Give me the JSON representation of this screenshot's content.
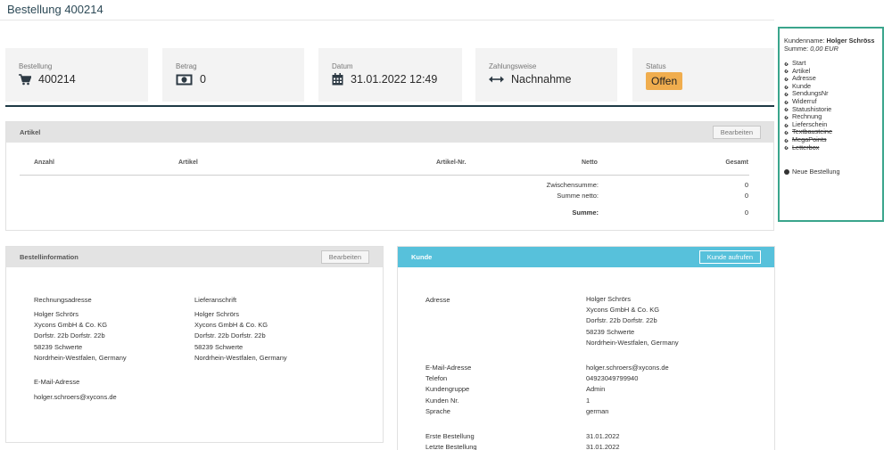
{
  "page": {
    "title": "Bestellung 400214"
  },
  "cards": [
    {
      "label": "Bestellung",
      "value": "400214",
      "icon": "cart-icon"
    },
    {
      "label": "Betrag",
      "value": "0",
      "icon": "money-icon"
    },
    {
      "label": "Datum",
      "value": "31.01.2022 12:49",
      "icon": "calendar-icon"
    },
    {
      "label": "Zahlungsweise",
      "value": "Nachnahme",
      "icon": "exchange-icon"
    },
    {
      "label": "Status",
      "value": "Offen",
      "badge_color": "#f0ad4e"
    }
  ],
  "artikel": {
    "title": "Artikel",
    "edit_label": "Bearbeiten",
    "columns": [
      "Anzahl",
      "Artikel",
      "Artikel-Nr.",
      "Netto",
      "Gesamt"
    ],
    "summary": [
      {
        "label": "Zwischensumme:",
        "value": "0"
      },
      {
        "label": "Summe netto:",
        "value": "0"
      },
      {
        "label": "Summe:",
        "value": "0"
      }
    ]
  },
  "bestellinfo": {
    "title": "Bestellinformation",
    "edit_label": "Bearbeiten",
    "rechnung_label": "Rechnungsadresse",
    "rechnung_lines": [
      "Holger Schrörs",
      "Xycons GmbH & Co. KG",
      "Dorfstr. 22b Dorfstr. 22b",
      "58239 Schwerte",
      "Nordrhein-Westfalen, Germany"
    ],
    "liefer_label": "Lieferanschrift",
    "liefer_lines": [
      "Holger Schrörs",
      "Xycons GmbH & Co. KG",
      "Dorfstr. 22b Dorfstr. 22b",
      "58239 Schwerte",
      "Nordrhein-Westfalen, Germany"
    ],
    "email_label": "E-Mail-Adresse",
    "email": "holger.schroers@xycons.de"
  },
  "kunde": {
    "title": "Kunde",
    "button_label": "Kunde aufrufen",
    "adresse_label": "Adresse",
    "adresse_lines": [
      "Holger Schrörs",
      "Xycons GmbH & Co. KG",
      "Dorfstr. 22b Dorfstr. 22b",
      "58239 Schwerte",
      "Nordrhein-Westfalen, Germany"
    ],
    "fields": [
      {
        "label": "E-Mail-Adresse",
        "value": "holger.schroers@xycons.de"
      },
      {
        "label": "Telefon",
        "value": "04923049799940"
      },
      {
        "label": "Kundengruppe",
        "value": "Admin"
      },
      {
        "label": "Kunden Nr.",
        "value": "1"
      },
      {
        "label": "Sprache",
        "value": "german"
      }
    ],
    "dates": [
      {
        "label": "Erste Bestellung",
        "value": "31.01.2022"
      },
      {
        "label": "Letzte Bestellung",
        "value": "31.01.2022"
      }
    ],
    "header_color": "#57c1db"
  },
  "sidebar": {
    "kundenname_label": "Kundenname:",
    "kundenname": "Holger Schröss",
    "summe_label": "Summe:",
    "summe": "0,00 EUR",
    "links": [
      {
        "label": "Start",
        "strike": false
      },
      {
        "label": "Artikel",
        "strike": false
      },
      {
        "label": "Adresse",
        "strike": false
      },
      {
        "label": "Kunde",
        "strike": false
      },
      {
        "label": "SendungsNr",
        "strike": false
      },
      {
        "label": "Widerruf",
        "strike": false
      },
      {
        "label": "Statushistorie",
        "strike": false
      },
      {
        "label": "Rechnung",
        "strike": false
      },
      {
        "label": "Lieferschein",
        "strike": false
      },
      {
        "label": "Textbausteine",
        "strike": true
      },
      {
        "label": "MegaPoints",
        "strike": true
      },
      {
        "label": "Letterbox",
        "strike": true
      }
    ],
    "new_order_label": "Neue Bestellung",
    "border_color": "#3aa58c"
  }
}
